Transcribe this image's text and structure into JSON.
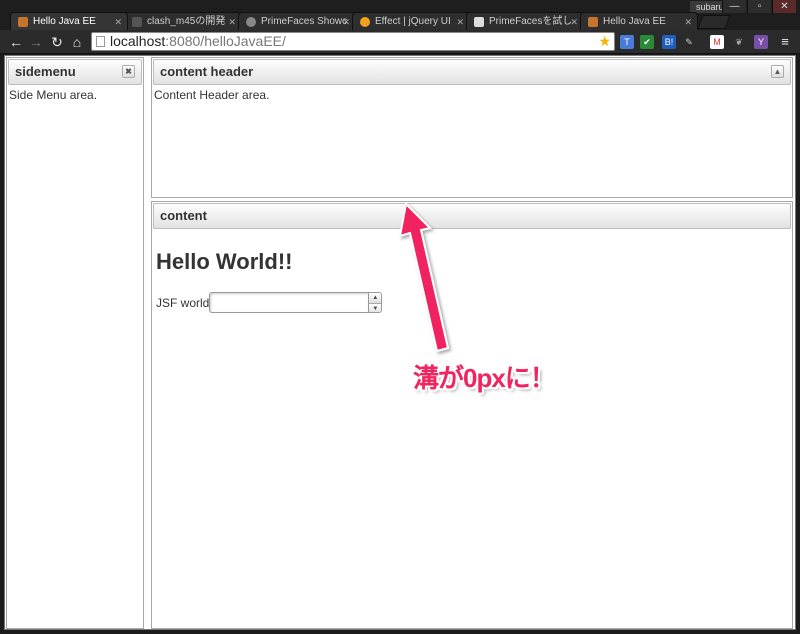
{
  "browser": {
    "user": "subaru",
    "tabs": [
      {
        "title": "Hello Java EE",
        "active": true
      },
      {
        "title": "clash_m45の開発",
        "active": false
      },
      {
        "title": "PrimeFaces Showc",
        "active": false
      },
      {
        "title": "Effect | jQuery UI",
        "active": false
      },
      {
        "title": "PrimeFacesを試し",
        "active": false
      },
      {
        "title": "Hello Java EE",
        "active": false
      }
    ],
    "url_host": "localhost",
    "url_path": ":8080/helloJavaEE/"
  },
  "layout": {
    "west": {
      "header": "sidemenu",
      "body": "Side Menu area."
    },
    "north": {
      "header": "content header",
      "body": "Content Header area."
    },
    "center": {
      "header": "content",
      "heading": "Hello World!!",
      "field_label": "JSF world",
      "field_value": ""
    }
  },
  "annotation": {
    "text": "溝が0pxに！",
    "color": "#f0245e"
  }
}
